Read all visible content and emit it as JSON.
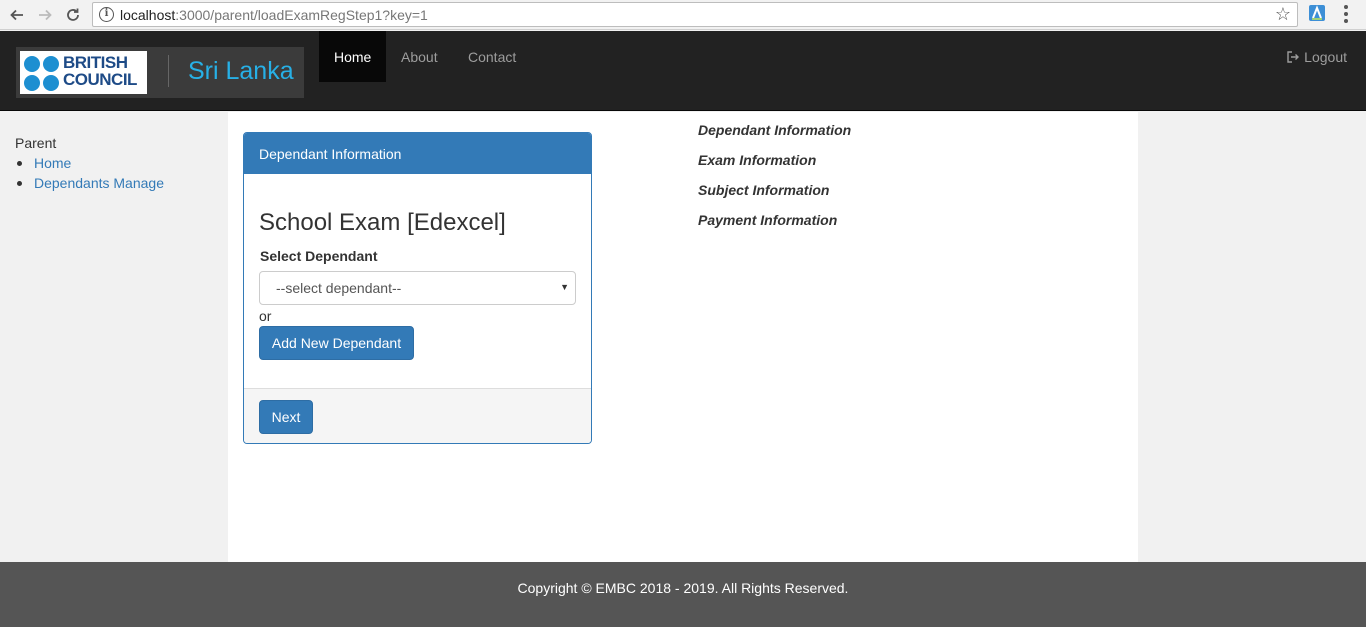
{
  "browser": {
    "url_host": "localhost",
    "url_rest": ":3000/parent/loadExamRegStep1?key=1"
  },
  "brand": {
    "logo_line1": "BRITISH",
    "logo_line2": "COUNCIL",
    "country": "Sri Lanka"
  },
  "navbar": {
    "items": [
      {
        "label": "Home",
        "active": true
      },
      {
        "label": "About",
        "active": false
      },
      {
        "label": "Contact",
        "active": false
      }
    ],
    "logout_label": "Logout"
  },
  "sidebar": {
    "heading": "Parent",
    "links": [
      {
        "label": "Home"
      },
      {
        "label": "Dependants Manage"
      }
    ]
  },
  "panel": {
    "heading": "Dependant Information",
    "exam_title": "School Exam [Edexcel]",
    "select_label": "Select Dependant",
    "select_value": "--select dependant--",
    "or_text": "or",
    "add_button": "Add New Dependant",
    "next_button": "Next"
  },
  "steps": [
    "Dependant Information",
    "Exam Information",
    "Subject Information",
    "Payment Information"
  ],
  "footer": {
    "copyright": "Copyright © EMBC 2018 - 2019. All Rights Reserved."
  },
  "colors": {
    "primary": "#337ab7",
    "navbar": "#222222",
    "footer": "#555555",
    "brand_blue": "#1d8fd1"
  }
}
